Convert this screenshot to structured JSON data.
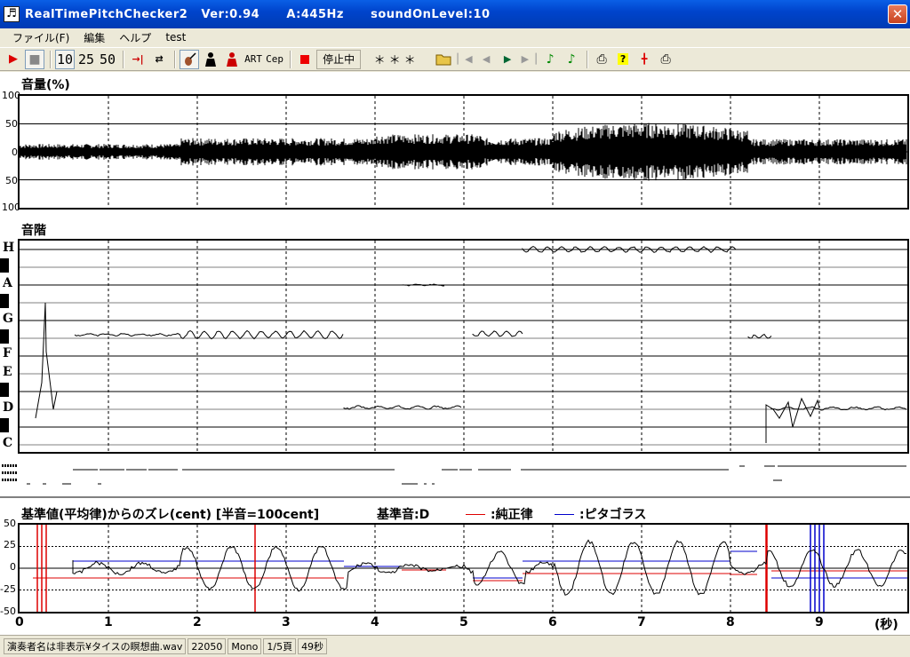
{
  "window": {
    "title": "RealTimePitchChecker2   Ver:0.94      A:445Hz      soundOnLevel:10",
    "close_glyph": "✕"
  },
  "menu": [
    "ファイル(F)",
    "編集",
    "ヘルプ",
    "test"
  ],
  "toolbar": {
    "play": "▶",
    "stop": "■",
    "speed_10": "10",
    "speed_25": "25",
    "speed_50": "50",
    "skip": "→|",
    "loop": "⇄",
    "art": "ART",
    "cep": "Cep",
    "state": "停止中",
    "stars": "＊＊＊"
  },
  "volume": {
    "title": "音量(%)",
    "ticks": [
      "100",
      "50",
      "0",
      "50",
      "100"
    ]
  },
  "scale": {
    "title": "音階",
    "notes": [
      "H",
      "A",
      "G",
      "F",
      "E",
      "D",
      "C"
    ]
  },
  "deviation": {
    "title": "基準値(平均律)からのズレ(cent) [半音=100cent]",
    "base_note": "基準音:D",
    "legend_just": ":純正律",
    "legend_pyth": ":ピタゴラス",
    "ticks": [
      "50",
      "25",
      "0",
      "-25",
      "-50"
    ]
  },
  "time_axis": {
    "labels": [
      "0",
      "1",
      "2",
      "3",
      "4",
      "5",
      "6",
      "7",
      "8",
      "9"
    ],
    "unit": "(秒)"
  },
  "statusbar": {
    "file": "演奏者名は非表示¥タイスの瞑想曲.wav",
    "rate": "22050",
    "channels": "Mono",
    "page": "1/5頁",
    "duration": "49秒"
  },
  "colors": {
    "titlebar": "#0044cc",
    "just": "#dd0000",
    "pyth": "#0000cc"
  }
}
